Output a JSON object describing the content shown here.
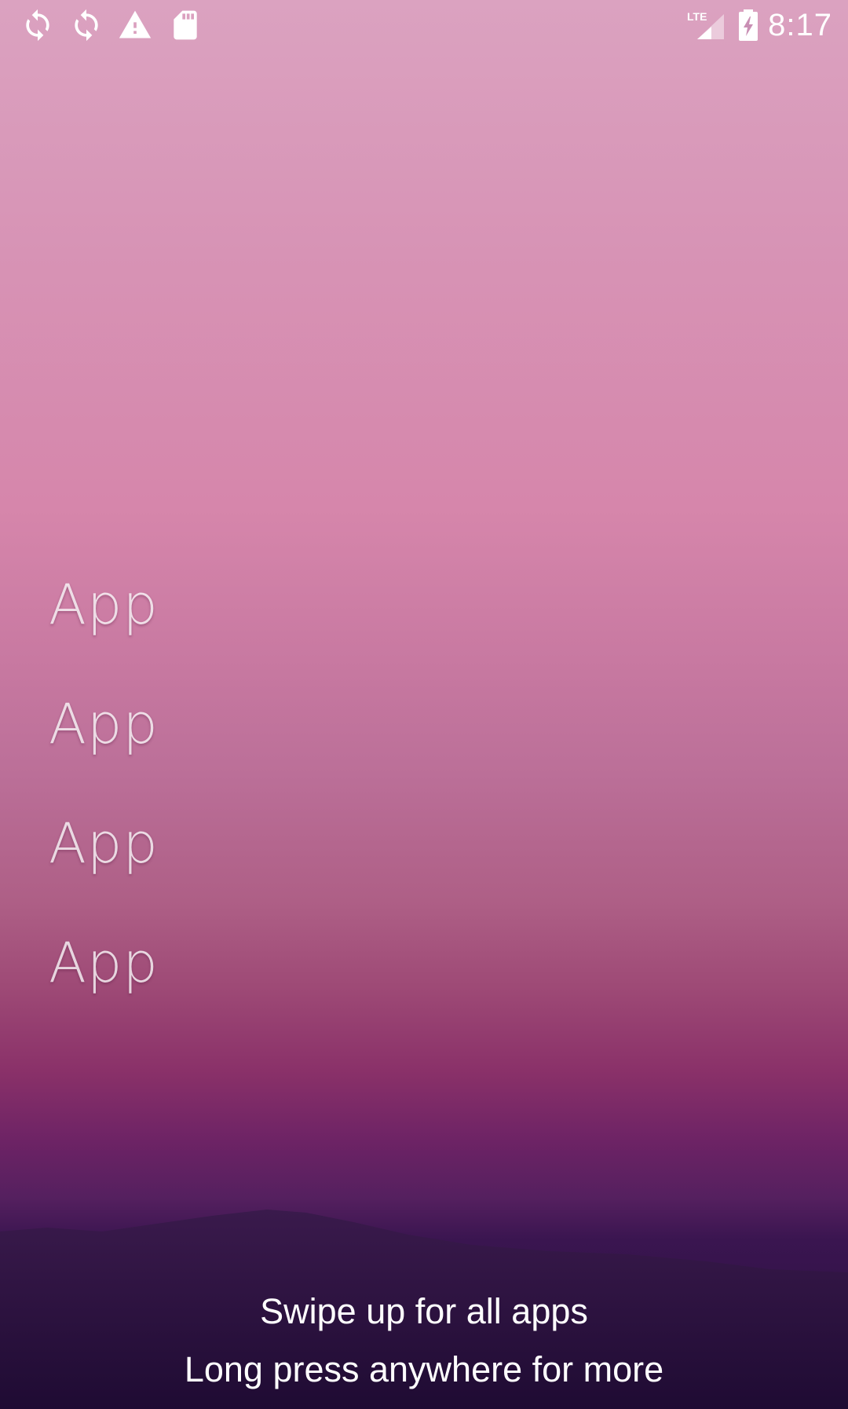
{
  "status_bar": {
    "left_icons": [
      "sync-icon",
      "sync-icon",
      "warning-icon",
      "sd-card-icon"
    ],
    "right_icons": [
      "lte-signal-icon",
      "battery-charging-icon"
    ],
    "network_label": "LTE",
    "time": "8:17"
  },
  "home": {
    "favorites": [
      {
        "label": "App"
      },
      {
        "label": "App"
      },
      {
        "label": "App"
      },
      {
        "label": "App"
      }
    ],
    "hint_swipe": "Swipe up for all apps",
    "hint_long_press": "Long press anywhere for more"
  },
  "colors": {
    "sky_top": "#dba2c0",
    "sky_mid": "#c97aa2",
    "horizon": "#8a3169",
    "hills": "#27103d"
  }
}
